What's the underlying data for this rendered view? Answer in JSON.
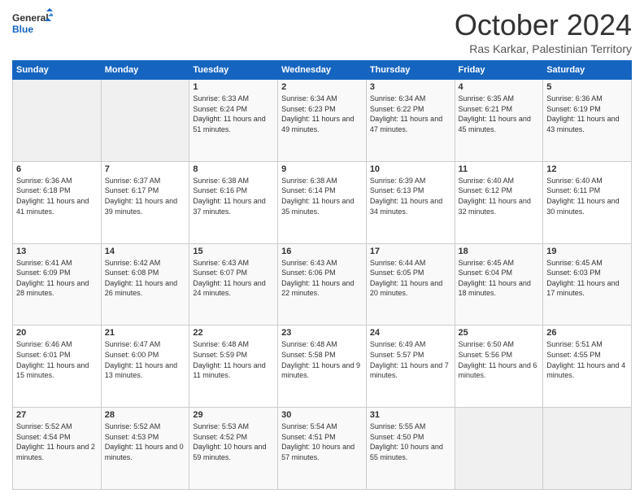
{
  "header": {
    "logo_line1": "General",
    "logo_line2": "Blue",
    "title": "October 2024",
    "subtitle": "Ras Karkar, Palestinian Territory"
  },
  "weekdays": [
    "Sunday",
    "Monday",
    "Tuesday",
    "Wednesday",
    "Thursday",
    "Friday",
    "Saturday"
  ],
  "rows": [
    [
      {
        "day": "",
        "info": ""
      },
      {
        "day": "",
        "info": ""
      },
      {
        "day": "1",
        "info": "Sunrise: 6:33 AM\nSunset: 6:24 PM\nDaylight: 11 hours and 51 minutes."
      },
      {
        "day": "2",
        "info": "Sunrise: 6:34 AM\nSunset: 6:23 PM\nDaylight: 11 hours and 49 minutes."
      },
      {
        "day": "3",
        "info": "Sunrise: 6:34 AM\nSunset: 6:22 PM\nDaylight: 11 hours and 47 minutes."
      },
      {
        "day": "4",
        "info": "Sunrise: 6:35 AM\nSunset: 6:21 PM\nDaylight: 11 hours and 45 minutes."
      },
      {
        "day": "5",
        "info": "Sunrise: 6:36 AM\nSunset: 6:19 PM\nDaylight: 11 hours and 43 minutes."
      }
    ],
    [
      {
        "day": "6",
        "info": "Sunrise: 6:36 AM\nSunset: 6:18 PM\nDaylight: 11 hours and 41 minutes."
      },
      {
        "day": "7",
        "info": "Sunrise: 6:37 AM\nSunset: 6:17 PM\nDaylight: 11 hours and 39 minutes."
      },
      {
        "day": "8",
        "info": "Sunrise: 6:38 AM\nSunset: 6:16 PM\nDaylight: 11 hours and 37 minutes."
      },
      {
        "day": "9",
        "info": "Sunrise: 6:38 AM\nSunset: 6:14 PM\nDaylight: 11 hours and 35 minutes."
      },
      {
        "day": "10",
        "info": "Sunrise: 6:39 AM\nSunset: 6:13 PM\nDaylight: 11 hours and 34 minutes."
      },
      {
        "day": "11",
        "info": "Sunrise: 6:40 AM\nSunset: 6:12 PM\nDaylight: 11 hours and 32 minutes."
      },
      {
        "day": "12",
        "info": "Sunrise: 6:40 AM\nSunset: 6:11 PM\nDaylight: 11 hours and 30 minutes."
      }
    ],
    [
      {
        "day": "13",
        "info": "Sunrise: 6:41 AM\nSunset: 6:09 PM\nDaylight: 11 hours and 28 minutes."
      },
      {
        "day": "14",
        "info": "Sunrise: 6:42 AM\nSunset: 6:08 PM\nDaylight: 11 hours and 26 minutes."
      },
      {
        "day": "15",
        "info": "Sunrise: 6:43 AM\nSunset: 6:07 PM\nDaylight: 11 hours and 24 minutes."
      },
      {
        "day": "16",
        "info": "Sunrise: 6:43 AM\nSunset: 6:06 PM\nDaylight: 11 hours and 22 minutes."
      },
      {
        "day": "17",
        "info": "Sunrise: 6:44 AM\nSunset: 6:05 PM\nDaylight: 11 hours and 20 minutes."
      },
      {
        "day": "18",
        "info": "Sunrise: 6:45 AM\nSunset: 6:04 PM\nDaylight: 11 hours and 18 minutes."
      },
      {
        "day": "19",
        "info": "Sunrise: 6:45 AM\nSunset: 6:03 PM\nDaylight: 11 hours and 17 minutes."
      }
    ],
    [
      {
        "day": "20",
        "info": "Sunrise: 6:46 AM\nSunset: 6:01 PM\nDaylight: 11 hours and 15 minutes."
      },
      {
        "day": "21",
        "info": "Sunrise: 6:47 AM\nSunset: 6:00 PM\nDaylight: 11 hours and 13 minutes."
      },
      {
        "day": "22",
        "info": "Sunrise: 6:48 AM\nSunset: 5:59 PM\nDaylight: 11 hours and 11 minutes."
      },
      {
        "day": "23",
        "info": "Sunrise: 6:48 AM\nSunset: 5:58 PM\nDaylight: 11 hours and 9 minutes."
      },
      {
        "day": "24",
        "info": "Sunrise: 6:49 AM\nSunset: 5:57 PM\nDaylight: 11 hours and 7 minutes."
      },
      {
        "day": "25",
        "info": "Sunrise: 6:50 AM\nSunset: 5:56 PM\nDaylight: 11 hours and 6 minutes."
      },
      {
        "day": "26",
        "info": "Sunrise: 5:51 AM\nSunset: 4:55 PM\nDaylight: 11 hours and 4 minutes."
      }
    ],
    [
      {
        "day": "27",
        "info": "Sunrise: 5:52 AM\nSunset: 4:54 PM\nDaylight: 11 hours and 2 minutes."
      },
      {
        "day": "28",
        "info": "Sunrise: 5:52 AM\nSunset: 4:53 PM\nDaylight: 11 hours and 0 minutes."
      },
      {
        "day": "29",
        "info": "Sunrise: 5:53 AM\nSunset: 4:52 PM\nDaylight: 10 hours and 59 minutes."
      },
      {
        "day": "30",
        "info": "Sunrise: 5:54 AM\nSunset: 4:51 PM\nDaylight: 10 hours and 57 minutes."
      },
      {
        "day": "31",
        "info": "Sunrise: 5:55 AM\nSunset: 4:50 PM\nDaylight: 10 hours and 55 minutes."
      },
      {
        "day": "",
        "info": ""
      },
      {
        "day": "",
        "info": ""
      }
    ]
  ]
}
